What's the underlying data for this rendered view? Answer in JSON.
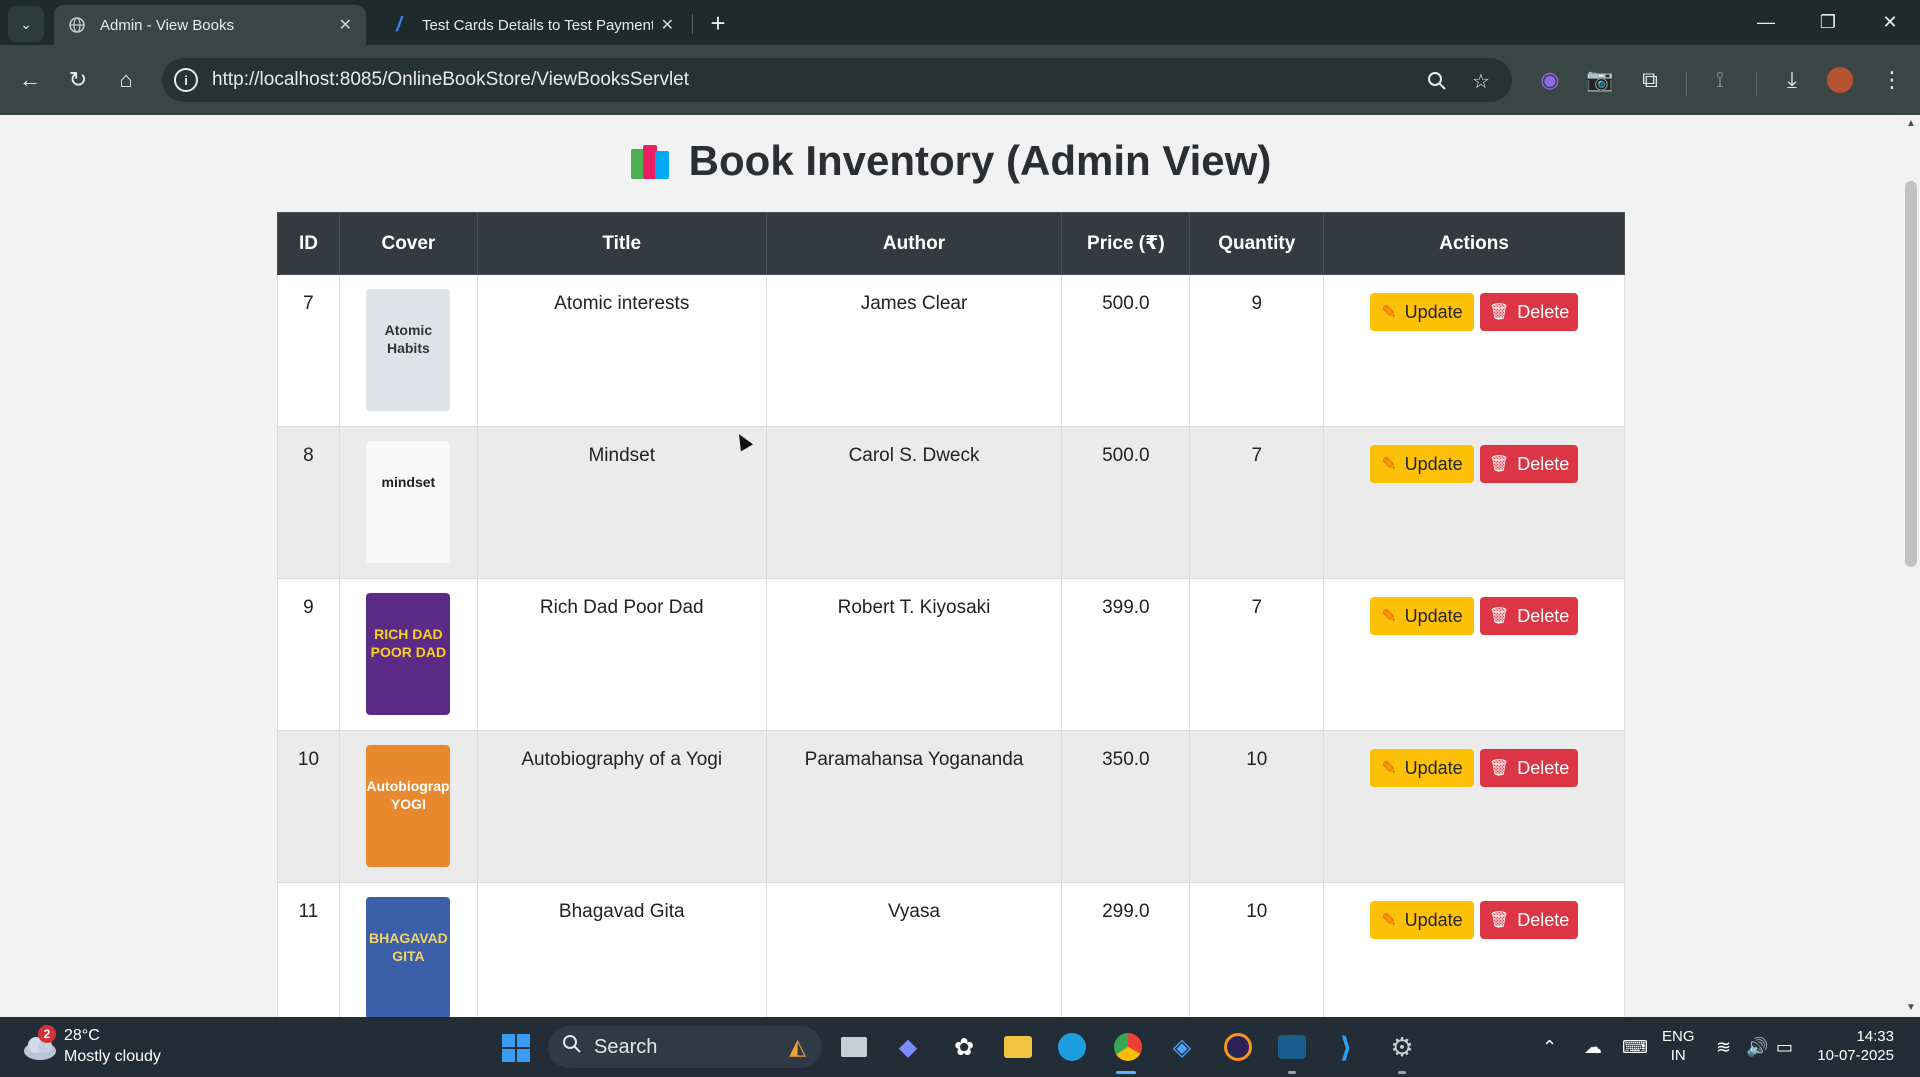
{
  "browser": {
    "tabs": [
      {
        "title": "Admin - View Books",
        "active": true
      },
      {
        "title": "Test Cards Details to Test Payment",
        "active": false
      }
    ],
    "url": "http://localhost:8085/OnlineBookStore/ViewBooksServlet"
  },
  "page": {
    "title": "Book Inventory (Admin View)",
    "columns": [
      "ID",
      "Cover",
      "Title",
      "Author",
      "Price (₹)",
      "Quantity",
      "Actions"
    ],
    "update_label": "Update",
    "delete_label": "Delete",
    "books": [
      {
        "id": "7",
        "title": "Atomic interests",
        "author": "James Clear",
        "price": "500.0",
        "quantity": "9",
        "cover_text": [
          "Atomic",
          "Habits"
        ],
        "cover_bg": "#dfe3e8",
        "cover_fg": "#333333"
      },
      {
        "id": "8",
        "title": "Mindset",
        "author": "Carol S. Dweck",
        "price": "500.0",
        "quantity": "7",
        "cover_text": [
          "mindset",
          ""
        ],
        "cover_bg": "#f8f8f8",
        "cover_fg": "#222222"
      },
      {
        "id": "9",
        "title": "Rich Dad Poor Dad",
        "author": "Robert T. Kiyosaki",
        "price": "399.0",
        "quantity": "7",
        "cover_text": [
          "RICH DAD",
          "POOR DAD"
        ],
        "cover_bg": "#5b2a86",
        "cover_fg": "#f7d21a"
      },
      {
        "id": "10",
        "title": "Autobiography of a Yogi",
        "author": "Paramahansa Yogananda",
        "price": "350.0",
        "quantity": "10",
        "cover_text": [
          "Autobiography",
          "YOGI"
        ],
        "cover_bg": "#e9892f",
        "cover_fg": "#ffffff"
      },
      {
        "id": "11",
        "title": "Bhagavad Gita",
        "author": "Vyasa",
        "price": "299.0",
        "quantity": "10",
        "cover_text": [
          "BHAGAVAD",
          "GITA"
        ],
        "cover_bg": "#3b5fa8",
        "cover_fg": "#f3d36a"
      }
    ]
  },
  "taskbar": {
    "weather_badge": "2",
    "temperature": "28°C",
    "weather": "Mostly cloudy",
    "search_placeholder": "Search",
    "lang_line1": "ENG",
    "lang_line2": "IN",
    "time": "14:33",
    "date": "10-07-2025"
  },
  "colors": {
    "update_button": "#ffc107",
    "delete_button": "#dc3545",
    "table_header": "#343a40",
    "chrome_dark": "#1f2b2b"
  }
}
